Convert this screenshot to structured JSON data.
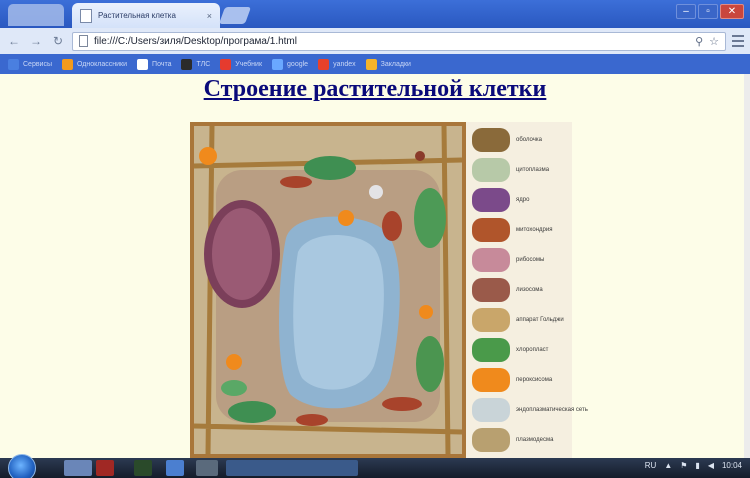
{
  "browser": {
    "tab_title": "Растительная клетка",
    "tab_close": "×",
    "url": "file:///C:/Users/зиля/Desktop/програма/1.html",
    "window_controls": {
      "minimize": "–",
      "maximize": "▫",
      "close": "✕"
    }
  },
  "bookmarks": [
    {
      "label": "Сервисы",
      "color": "#4a7fe0"
    },
    {
      "label": "Одноклассники",
      "color": "#f39a1c"
    },
    {
      "label": "Почта",
      "color": "#ffffff"
    },
    {
      "label": "ТЛС",
      "color": "#2b2b2b"
    },
    {
      "label": "Учебник",
      "color": "#e53b2e"
    },
    {
      "label": "google",
      "color": "#6aa8ff"
    },
    {
      "label": "yandex",
      "color": "#e8412a"
    },
    {
      "label": "Закладки",
      "color": "#f5b42a"
    }
  ],
  "page": {
    "title": "Строение растительной клетки",
    "background": "#fdfde8",
    "title_color": "#0a0a7a"
  },
  "legend": [
    {
      "label": "оболочка",
      "color": "#8a6a3a"
    },
    {
      "label": "цитоплазма",
      "color": "#b7c9a8"
    },
    {
      "label": "ядро",
      "color": "#7b4a8a"
    },
    {
      "label": "митохондрия",
      "color": "#b0552b"
    },
    {
      "label": "рибосомы",
      "color": "#c78a9a"
    },
    {
      "label": "лизосома",
      "color": "#9a5a4a"
    },
    {
      "label": "аппарат Гольджи",
      "color": "#c9a66a"
    },
    {
      "label": "хлоропласт",
      "color": "#4a9a4a"
    },
    {
      "label": "пероксисома",
      "color": "#f08a1c"
    },
    {
      "label": "эндоплазматическая сеть",
      "color": "#c9d4d8"
    },
    {
      "label": "плазмодесма",
      "color": "#b8a070"
    }
  ],
  "taskbar": {
    "lang": "RU",
    "time": "10:04"
  },
  "icons": [
    "page-icon",
    "search-icon",
    "star-icon",
    "menu-icon",
    "back-icon",
    "forward-icon",
    "reload-icon",
    "windows-start-icon"
  ]
}
